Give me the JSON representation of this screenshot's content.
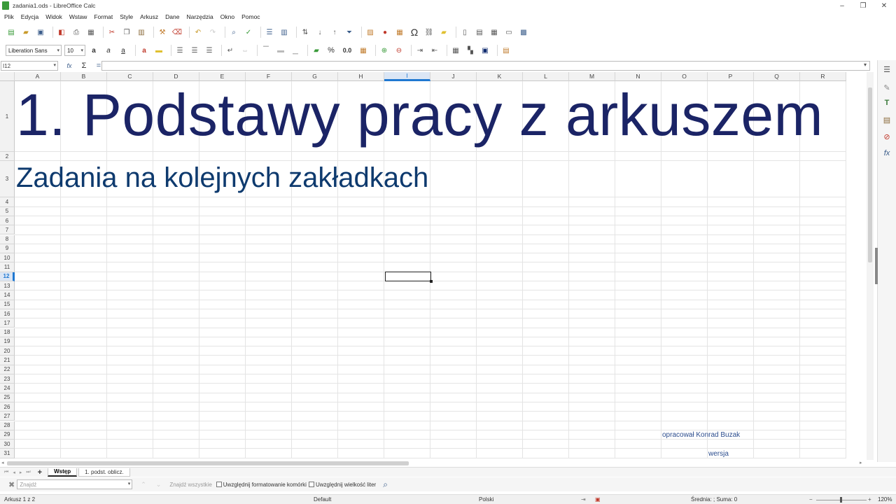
{
  "window": {
    "title": "zadania1.ods - LibreOffice Calc"
  },
  "menu": [
    "Plik",
    "Edycja",
    "Widok",
    "Wstaw",
    "Format",
    "Style",
    "Arkusz",
    "Dane",
    "Narzędzia",
    "Okno",
    "Pomoc"
  ],
  "format_bar": {
    "font_name": "Liberation Sans",
    "font_size": "10",
    "percent_label": "%",
    "decimal_label": "0.0"
  },
  "formula_bar": {
    "name_box": "I12",
    "formula": ""
  },
  "columns": [
    "A",
    "B",
    "C",
    "D",
    "E",
    "F",
    "G",
    "H",
    "I",
    "J",
    "K",
    "L",
    "M",
    "N",
    "O",
    "P",
    "Q",
    "R"
  ],
  "active_column": "I",
  "rows": [
    "1",
    "2",
    "3",
    "4",
    "5",
    "6",
    "7",
    "8",
    "9",
    "10",
    "11",
    "12",
    "13",
    "14",
    "15",
    "16",
    "17",
    "18",
    "19",
    "20",
    "21",
    "22",
    "23",
    "24",
    "25",
    "26",
    "27",
    "28",
    "29",
    "30",
    "31"
  ],
  "active_row": "12",
  "cells": {
    "title": "1. Podstawy pracy z arkuszem",
    "subtitle": "Zadania na kolejnych zakładkach",
    "author": "opracował Konrad Buzak",
    "version": "wersja"
  },
  "sheet_tabs": [
    {
      "label": "Wstęp",
      "active": true
    },
    {
      "label": "1. podst. oblicz.",
      "active": false
    }
  ],
  "findbar": {
    "placeholder": "Znajdź",
    "find_all": "Znajdź wszystkie",
    "match_formatting": "Uwzględnij formatowanie komórki",
    "match_case": "Uwzględnij wielkość liter"
  },
  "status": {
    "sheet": "Arkusz 1 z 2",
    "style": "Default",
    "language": "Polski",
    "summary": "Średnia: ; Suma: 0",
    "zoom": "120%"
  },
  "colors": {
    "title": "#1b2466",
    "subtitle": "#0e3a6e",
    "accent": "#1f78d1"
  }
}
